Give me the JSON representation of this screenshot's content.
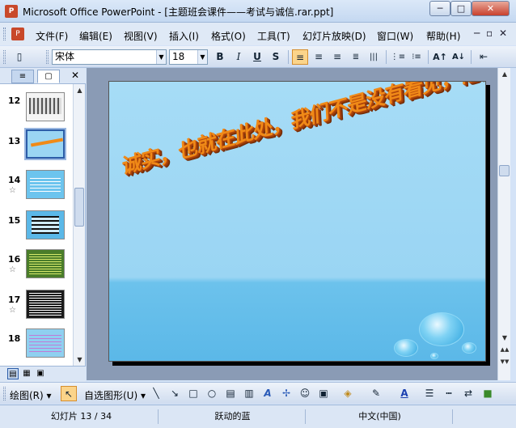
{
  "window": {
    "app_icon": "P",
    "title": "Microsoft Office PowerPoint - [主题班会课件——考试与诚信.rar.ppt]",
    "min_label": "─",
    "max_label": "□",
    "close_label": "✕"
  },
  "menubar": {
    "doc_icon": "P",
    "items": [
      "文件(F)",
      "编辑(E)",
      "视图(V)",
      "插入(I)",
      "格式(O)",
      "工具(T)",
      "幻灯片放映(D)",
      "窗口(W)",
      "帮助(H)"
    ],
    "ctrl_min": "─",
    "ctrl_restore": "▫",
    "ctrl_close": "✕"
  },
  "toolbar": {
    "font_name": "宋体",
    "font_size": "18",
    "bold": "B",
    "italic": "I",
    "underline": "U",
    "shadow": "S",
    "align_left": "≡",
    "align_center": "≡",
    "align_right": "≡",
    "distribute": "|||",
    "numbering": "⋮≡",
    "bullets": "⁝≡",
    "grow_font": "A↑",
    "shrink_font": "A↓",
    "indent": "⇤"
  },
  "panel": {
    "outline_tab": "≡",
    "slides_tab": "▢",
    "close": "✕",
    "thumbnails": [
      {
        "num": "12",
        "star": "",
        "selected": false,
        "bg": "#f4f4f4"
      },
      {
        "num": "13",
        "star": "",
        "selected": true,
        "bg": "#9ad5f3"
      },
      {
        "num": "14",
        "star": "☆",
        "selected": false,
        "bg": "#6cc4ee"
      },
      {
        "num": "15",
        "star": "",
        "selected": false,
        "bg": "#5bb8e8"
      },
      {
        "num": "16",
        "star": "☆",
        "selected": false,
        "bg": "#4a7d2a"
      },
      {
        "num": "17",
        "star": "☆",
        "selected": false,
        "bg": "#1a1a1a"
      },
      {
        "num": "18",
        "star": "",
        "selected": false,
        "bg": "#8fd0f0"
      }
    ]
  },
  "slide": {
    "text": "诚实，也就在此处，我们不是没有看见，他是不愿……"
  },
  "drawbar": {
    "draw_label": "绘图(R)",
    "autoshape_label": "自选图形(U)",
    "cursor": "↖",
    "line": "╲",
    "arrow": "↘",
    "rect": "□",
    "oval": "○",
    "textbox": "▤",
    "vtextbox": "▥",
    "wordart": "A",
    "diagram": "✢",
    "clipart": "☺",
    "picture": "▣",
    "fill": "◈",
    "line_color": "✎",
    "font_color": "A",
    "line_style": "☰",
    "dash_style": "┅",
    "arrow_style": "⇄",
    "shadow_3d": "■"
  },
  "statusbar": {
    "slide_info": "幻灯片 13 / 34",
    "design": "跃动的蓝",
    "language": "中文(中国)"
  },
  "colors": {
    "accent": "#fbd48a",
    "slide_text": "#f08a17"
  }
}
